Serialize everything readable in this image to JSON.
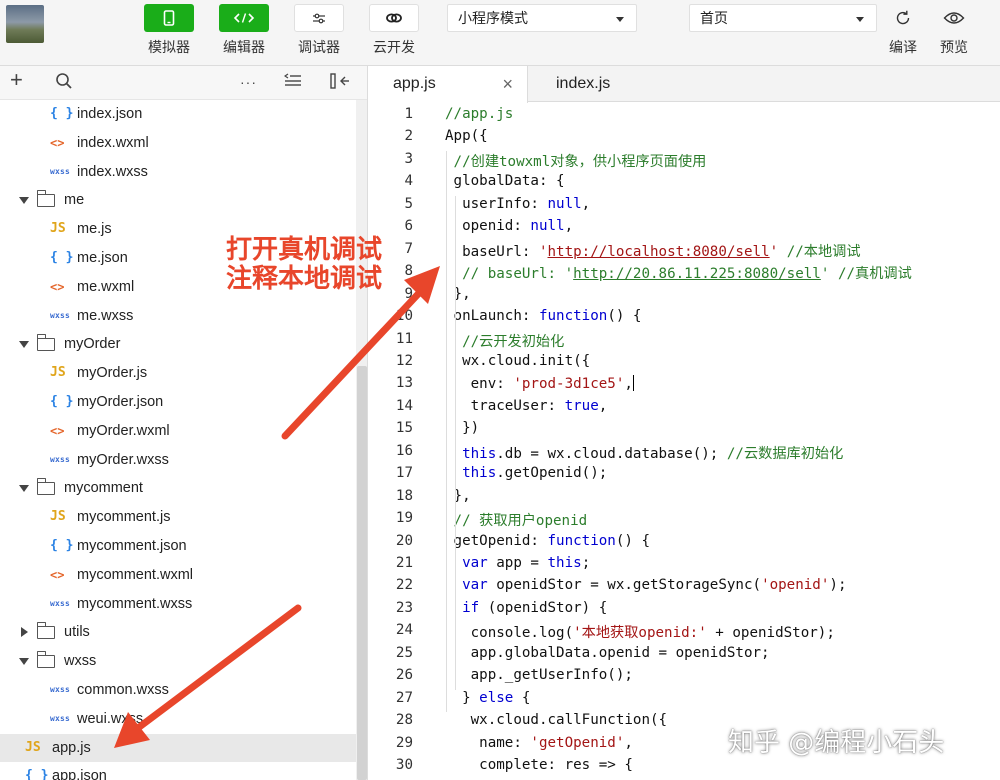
{
  "toolbar": {
    "tools": [
      {
        "label": "模拟器",
        "icon": "phone-icon"
      },
      {
        "label": "编辑器",
        "icon": "code-icon"
      },
      {
        "label": "调试器",
        "icon": "sliders-icon"
      },
      {
        "label": "云开发",
        "icon": "cloud-icon"
      }
    ],
    "mode_select": "小程序模式",
    "page_select": "首页",
    "compile_label": "编译",
    "preview_label": "预览"
  },
  "sidebar": {
    "tools": {
      "add": "+",
      "more": "···"
    },
    "tree": [
      {
        "name": "index.json",
        "type": "json"
      },
      {
        "name": "index.wxml",
        "type": "wxml"
      },
      {
        "name": "index.wxss",
        "type": "wxss"
      },
      {
        "name": "me",
        "type": "folder",
        "open": true
      },
      {
        "name": "me.js",
        "type": "js"
      },
      {
        "name": "me.json",
        "type": "json"
      },
      {
        "name": "me.wxml",
        "type": "wxml"
      },
      {
        "name": "me.wxss",
        "type": "wxss"
      },
      {
        "name": "myOrder",
        "type": "folder",
        "open": true
      },
      {
        "name": "myOrder.js",
        "type": "js"
      },
      {
        "name": "myOrder.json",
        "type": "json"
      },
      {
        "name": "myOrder.wxml",
        "type": "wxml"
      },
      {
        "name": "myOrder.wxss",
        "type": "wxss"
      },
      {
        "name": "mycomment",
        "type": "folder",
        "open": true
      },
      {
        "name": "mycomment.js",
        "type": "js"
      },
      {
        "name": "mycomment.json",
        "type": "json"
      },
      {
        "name": "mycomment.wxml",
        "type": "wxml"
      },
      {
        "name": "mycomment.wxss",
        "type": "wxss"
      },
      {
        "name": "utils",
        "type": "folder",
        "open": false
      },
      {
        "name": "wxss",
        "type": "folder",
        "open": true
      },
      {
        "name": "common.wxss",
        "type": "wxss"
      },
      {
        "name": "weui.wxss",
        "type": "wxss"
      },
      {
        "name": "app.js",
        "type": "js",
        "selected": true
      },
      {
        "name": "app.json",
        "type": "json"
      }
    ],
    "icon_glyphs": {
      "json": "{ }",
      "wxml": "<>",
      "wxss": "wxss",
      "js": "JS"
    }
  },
  "editor": {
    "tabs": [
      {
        "name": "app.js",
        "active": true,
        "close": "×"
      },
      {
        "name": "index.js",
        "active": false
      }
    ],
    "lines": [
      [
        [
          "c",
          "//app.js"
        ]
      ],
      [
        [
          "p",
          "App({"
        ]
      ],
      [
        [
          "p",
          " "
        ],
        [
          "c",
          "//创建towxml对象，供小程序页面使用"
        ]
      ],
      [
        [
          "p",
          " globalData: {"
        ]
      ],
      [
        [
          "p",
          "  userInfo: "
        ],
        [
          "k",
          "null"
        ],
        [
          "p",
          ","
        ]
      ],
      [
        [
          "p",
          "  openid: "
        ],
        [
          "k",
          "null"
        ],
        [
          "p",
          ","
        ]
      ],
      [
        [
          "p",
          "  baseUrl: "
        ],
        [
          "s",
          "'"
        ],
        [
          "su",
          "http://localhost:8080/sell"
        ],
        [
          "s",
          "'"
        ],
        [
          "p",
          " "
        ],
        [
          "c",
          "//本地调试"
        ]
      ],
      [
        [
          "p",
          "  "
        ],
        [
          "c",
          "// baseUrl: '"
        ],
        [
          "cu",
          "http://20.86.11.225:8080/sell"
        ],
        [
          "c",
          "' //真机调试"
        ]
      ],
      [
        [
          "p",
          " },"
        ]
      ],
      [
        [
          "p",
          " onLaunch: "
        ],
        [
          "k",
          "function"
        ],
        [
          "p",
          "() {"
        ]
      ],
      [
        [
          "p",
          "  "
        ],
        [
          "c",
          "//云开发初始化"
        ]
      ],
      [
        [
          "p",
          "  wx.cloud.init({"
        ]
      ],
      [
        [
          "p",
          "   env: "
        ],
        [
          "s",
          "'prod-3d1ce5'"
        ],
        [
          "p",
          ","
        ],
        [
          "cur",
          ""
        ]
      ],
      [
        [
          "p",
          "   traceUser: "
        ],
        [
          "k",
          "true"
        ],
        [
          "p",
          ","
        ]
      ],
      [
        [
          "p",
          "  })"
        ]
      ],
      [
        [
          "p",
          "  "
        ],
        [
          "k",
          "this"
        ],
        [
          "p",
          ".db = wx.cloud.database(); "
        ],
        [
          "c",
          "//云数据库初始化"
        ]
      ],
      [
        [
          "p",
          "  "
        ],
        [
          "k",
          "this"
        ],
        [
          "p",
          ".getOpenid();"
        ]
      ],
      [
        [
          "p",
          " },"
        ]
      ],
      [
        [
          "p",
          " "
        ],
        [
          "c",
          "// 获取用户openid"
        ]
      ],
      [
        [
          "p",
          " getOpenid: "
        ],
        [
          "k",
          "function"
        ],
        [
          "p",
          "() {"
        ]
      ],
      [
        [
          "p",
          "  "
        ],
        [
          "k",
          "var"
        ],
        [
          "p",
          " app = "
        ],
        [
          "k",
          "this"
        ],
        [
          "p",
          ";"
        ]
      ],
      [
        [
          "p",
          "  "
        ],
        [
          "k",
          "var"
        ],
        [
          "p",
          " openidStor = wx.getStorageSync("
        ],
        [
          "s",
          "'openid'"
        ],
        [
          "p",
          ");"
        ]
      ],
      [
        [
          "p",
          "  "
        ],
        [
          "k",
          "if"
        ],
        [
          "p",
          " (openidStor) {"
        ]
      ],
      [
        [
          "p",
          "   console.log("
        ],
        [
          "s",
          "'本地获取openid:'"
        ],
        [
          "p",
          " + openidStor);"
        ]
      ],
      [
        [
          "p",
          "   app.globalData.openid = openidStor;"
        ]
      ],
      [
        [
          "p",
          "   app._getUserInfo();"
        ]
      ],
      [
        [
          "p",
          "  } "
        ],
        [
          "k",
          "else"
        ],
        [
          "p",
          " {"
        ]
      ],
      [
        [
          "p",
          "   wx.cloud.callFunction({"
        ]
      ],
      [
        [
          "p",
          "    name: "
        ],
        [
          "s",
          "'getOpenid'"
        ],
        [
          "p",
          ","
        ]
      ],
      [
        [
          "p",
          "    complete: res => {"
        ]
      ]
    ],
    "first_line_number": 1
  },
  "annotation": {
    "line1": "打开真机调试",
    "line2": "注释本地调试"
  },
  "watermark": "知乎 @编程小石头",
  "colors": {
    "accent_green": "#1aad19",
    "annotation_red": "#e8462b",
    "comment": "#2c7d2c",
    "string": "#a31515",
    "keyword": "#0000d0"
  }
}
